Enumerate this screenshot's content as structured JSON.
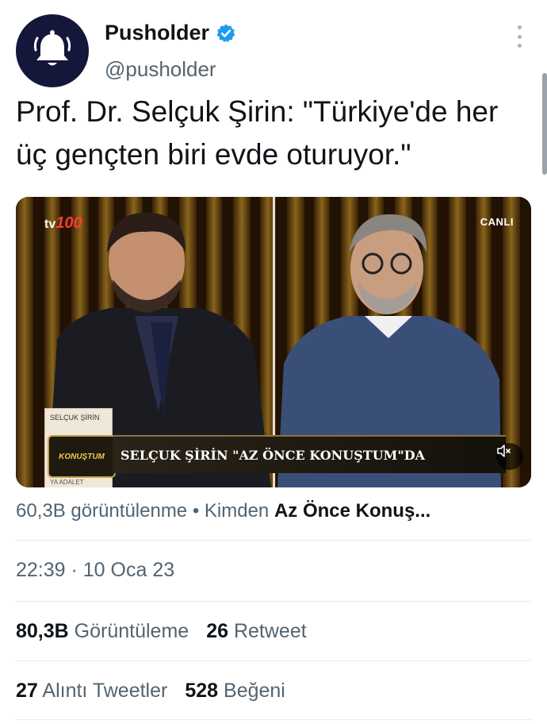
{
  "author": {
    "name": "Pusholder",
    "handle": "@pusholder"
  },
  "tweet": {
    "text": "Prof. Dr. Selçuk Şirin: \"Türkiye'de her üç gençten biri evde oturuyor.\""
  },
  "media": {
    "channel_logo": "tv100",
    "channel_prefix": "tv",
    "channel_number": "100",
    "live_badge": "CANLI",
    "book_title": "SELÇUK ŞİRİN",
    "book_subtitle": "YA ADALET",
    "show_logo": "KONUŞTUM",
    "lower_third": "SELÇUK ŞİRİN \"AZ ÖNCE KONUŞTUM\"DA"
  },
  "video_meta": {
    "views": "60,3B görüntülenme",
    "separator": "•",
    "from_label": "Kimden",
    "source": "Az Önce Konuş..."
  },
  "timestamp": "22:39 · 10 Oca 23",
  "stats": {
    "views_count": "80,3B",
    "views_label": "Görüntüleme",
    "retweets_count": "26",
    "retweets_label": "Retweet",
    "quotes_count": "27",
    "quotes_label": "Alıntı Tweetler",
    "likes_count": "528",
    "likes_label": "Beğeni"
  },
  "colors": {
    "verified": "#1d9bf0",
    "avatar_bg": "#14163a",
    "secondary_text": "#536471",
    "primary_text": "#0f1419"
  },
  "icons": {
    "avatar": "bell-icon",
    "verified": "verified-badge-icon",
    "more": "more-vertical-icon",
    "mute": "speaker-muted-icon"
  }
}
